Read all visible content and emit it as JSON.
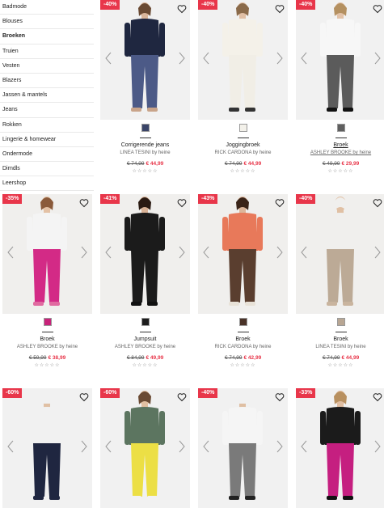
{
  "sidebar": {
    "items": [
      {
        "label": "Badmode",
        "active": false
      },
      {
        "label": "Blouses",
        "active": false
      },
      {
        "label": "Broeken",
        "active": true
      },
      {
        "label": "Truien",
        "active": false
      },
      {
        "label": "Vesten",
        "active": false
      },
      {
        "label": "Blazers",
        "active": false
      },
      {
        "label": "Jassen & mantels",
        "active": false
      },
      {
        "label": "Jeans",
        "active": false
      },
      {
        "label": "Rokken",
        "active": false
      },
      {
        "label": "Lingerie & homewear",
        "active": false
      },
      {
        "label": "Ondermode",
        "active": false
      },
      {
        "label": "Dirndls",
        "active": false
      },
      {
        "label": "Leershop",
        "active": false
      }
    ]
  },
  "products": [
    {
      "badge": "-40%",
      "name": "Corrigerende jeans",
      "brand": "LINEA TESINI by heine",
      "old_price": "€ 74,99",
      "new_price": "€ 44,99",
      "swatch": "#3a4468",
      "stars": "☆☆☆☆☆"
    },
    {
      "badge": "-40%",
      "name": "Joggingbroek",
      "brand": "RICK CARDONA by heine",
      "old_price": "€ 74,99",
      "new_price": "€ 44,99",
      "swatch": "#f3f1ea",
      "stars": "☆☆☆☆☆"
    },
    {
      "badge": "-40%",
      "name": "Broek",
      "brand": "ASHLEY BROOKE by heine",
      "old_price": "€ 49,99",
      "new_price": "€ 29,99",
      "swatch": "#5f5f5f",
      "stars": "☆☆☆☆☆"
    },
    {
      "badge": "-35%",
      "name": "Broek",
      "brand": "ASHLEY BROOKE by heine",
      "old_price": "€ 59,99",
      "new_price": "€ 38,99",
      "swatch": "#c8237a",
      "stars": "☆☆☆☆☆"
    },
    {
      "badge": "-41%",
      "name": "Jumpsuit",
      "brand": "ASHLEY BROOKE by heine",
      "old_price": "€ 84,99",
      "new_price": "€ 49,99",
      "swatch": "#1d1d1d",
      "stars": "☆☆☆☆☆"
    },
    {
      "badge": "-43%",
      "name": "Broek",
      "brand": "RICK CARDONA by heine",
      "old_price": "€ 74,99",
      "new_price": "€ 42,99",
      "swatch": "#4a3328",
      "stars": "☆☆☆☆☆"
    },
    {
      "badge": "-40%",
      "name": "Broek",
      "brand": "LINEA TESINI by heine",
      "old_price": "€ 74,99",
      "new_price": "€ 44,99",
      "swatch": "#b8a693",
      "stars": "☆☆☆☆☆"
    },
    {
      "badge": "-60%",
      "name": "",
      "brand": "",
      "old_price": "",
      "new_price": "",
      "swatch": "#1e2540",
      "stars": ""
    },
    {
      "badge": "-60%",
      "name": "",
      "brand": "",
      "old_price": "",
      "new_price": "",
      "swatch": "#e8dd3f",
      "stars": ""
    },
    {
      "badge": "-40%",
      "name": "",
      "brand": "",
      "old_price": "",
      "new_price": "",
      "swatch": "#6b6b6b",
      "stars": ""
    },
    {
      "badge": "-33%",
      "name": "",
      "brand": "",
      "old_price": "",
      "new_price": "",
      "swatch": "#c21f7f",
      "stars": ""
    }
  ],
  "colors": {
    "sale_red": "#e8364a",
    "accent": "#222222"
  }
}
